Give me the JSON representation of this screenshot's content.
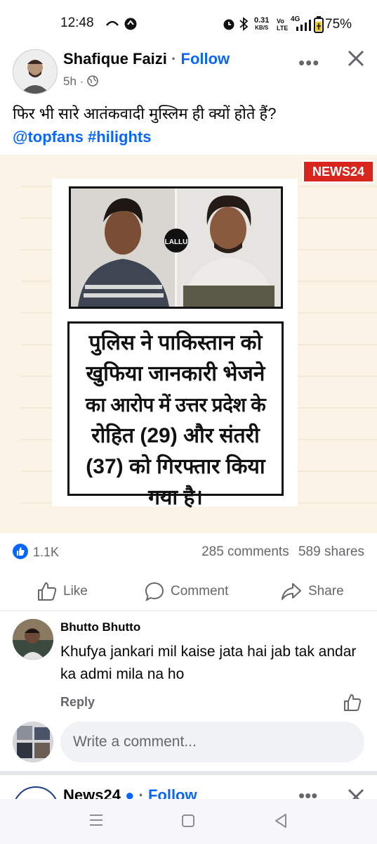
{
  "status_bar": {
    "time": "12:48",
    "net_speed": "0.31",
    "net_unit": "KB/S",
    "signal_label": "4G",
    "battery": "75%"
  },
  "post": {
    "author": "Shafique Faizi",
    "follow_label": "Follow",
    "time": "5h",
    "caption": "फिर भी सारे आतंकवादी मुस्लिम ही क्यों होते हैं?",
    "tags": "@topfans #hilights",
    "image": {
      "logo_text": "NEWS24",
      "watermark": "THE LALLU TOP",
      "headline_lines": [
        "पुलिस ने पाकिस्तान को",
        "खुफिया जानकारी भेजने",
        "का आरोप में उत्तर प्रदेश के",
        "रोहित (29) और संतरी",
        "(37) को गिरफ्तार किया",
        "गया है।"
      ]
    },
    "reactions": "1.1K",
    "comments": "285 comments",
    "shares": "589 shares",
    "actions": {
      "like": "Like",
      "comment": "Comment",
      "share": "Share"
    }
  },
  "comment": {
    "author": "Bhutto Bhutto",
    "text": "Khufya jankari mil kaise jata hai jab tak andar ka admi mila na ho",
    "reply_label": "Reply"
  },
  "composer": {
    "placeholder": "Write a comment..."
  },
  "next_post": {
    "author": "News24",
    "follow_label": "Follow"
  },
  "colors": {
    "accent": "#0866ff",
    "muted": "#65676b",
    "divider": "#e4e6eb",
    "news_red": "#d8261f"
  }
}
